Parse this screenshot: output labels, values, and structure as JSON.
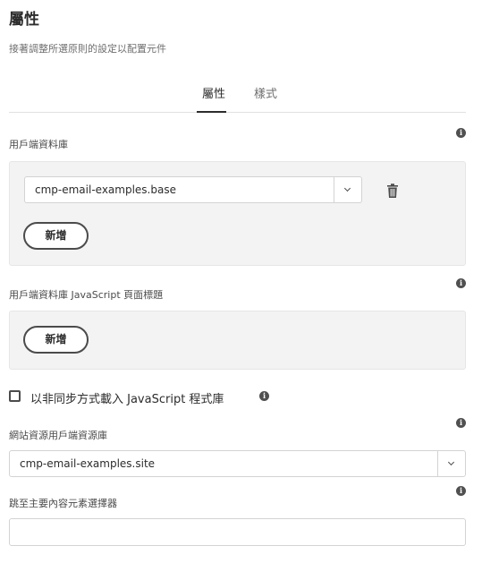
{
  "page": {
    "title": "屬性",
    "subtitle": "接著調整所選原則的設定以配置元件"
  },
  "tabs": [
    {
      "label": "屬性",
      "active": true
    },
    {
      "label": "樣式",
      "active": false
    }
  ],
  "client_library": {
    "label": "用戶端資料庫",
    "value": "cmp-email-examples.base",
    "add_label": "新增"
  },
  "client_library_js_head": {
    "label": "用戶端資料庫 JavaScript 頁面標題",
    "add_label": "新增"
  },
  "async_load": {
    "label": "以非同步方式載入 JavaScript 程式庫",
    "checked": false
  },
  "site_resources": {
    "label": "網站資源用戶端資源庫",
    "value": "cmp-email-examples.site"
  },
  "skip_to_main": {
    "label": "跳至主要內容元素選擇器",
    "value": ""
  },
  "icons": {
    "info": "info-icon",
    "delete": "trash-icon",
    "dropdown": "chevron-down-icon"
  },
  "colors": {
    "text": "#2c2c2c",
    "panel_bg": "#f3f3f3",
    "border": "#d3d3d3"
  }
}
